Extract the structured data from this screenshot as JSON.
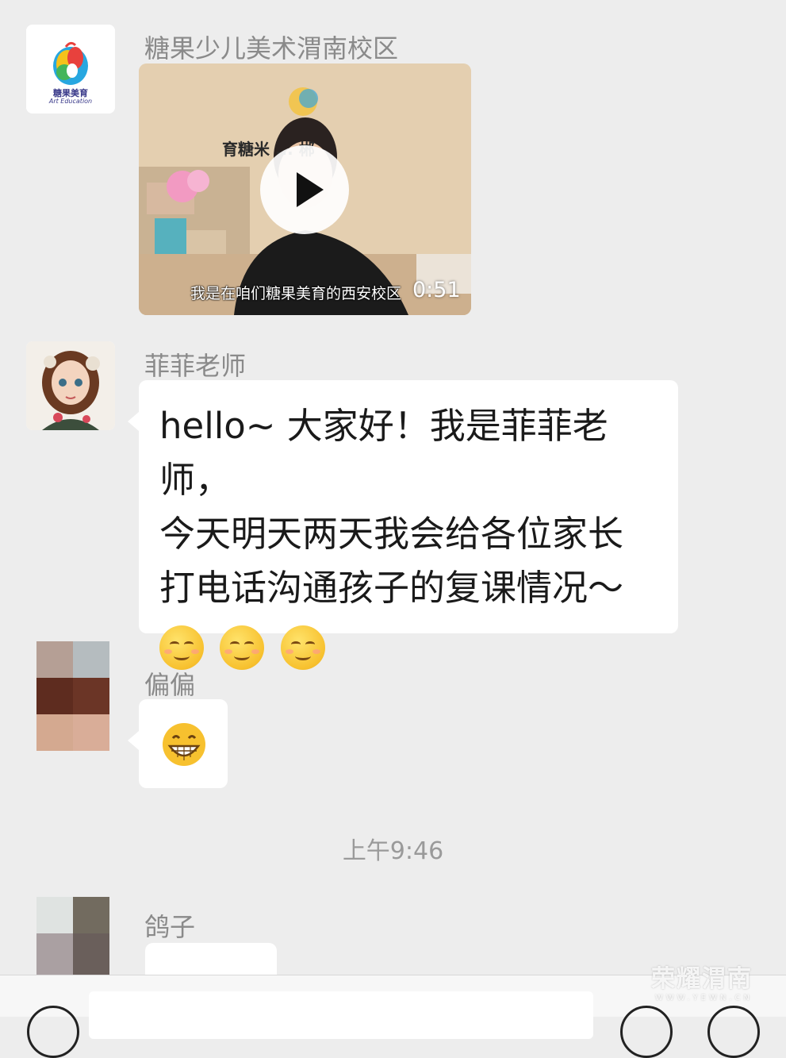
{
  "messages": [
    {
      "sender": "糖果少儿美术渭南校区",
      "video": {
        "wall_sign": "育糖米 ... 郴",
        "subtitle": "我是在咱们糖果美育的西安校区",
        "duration": "0:51"
      },
      "avatar_text_1": "糖果美育",
      "avatar_text_2": "Art Education"
    },
    {
      "sender": "菲菲老师",
      "text_lines": [
        "hello~ 大家好！我是菲菲老师，",
        "今天明天两天我会给各位家长",
        "打电话沟通孩子的复课情况～"
      ],
      "emoji_count": 3
    },
    {
      "sender": "偏偏",
      "emoji": "grin"
    }
  ],
  "timestamp": "上午9:46",
  "last_message": {
    "sender": "鸽子"
  },
  "watermark": {
    "title": "荣耀渭南",
    "url": "WWW.YEWN.CN"
  },
  "colors": {
    "background": "#ededed",
    "bubble": "#ffffff",
    "sender_name": "#8a8a8a",
    "timestamp": "#9a9a9a"
  }
}
